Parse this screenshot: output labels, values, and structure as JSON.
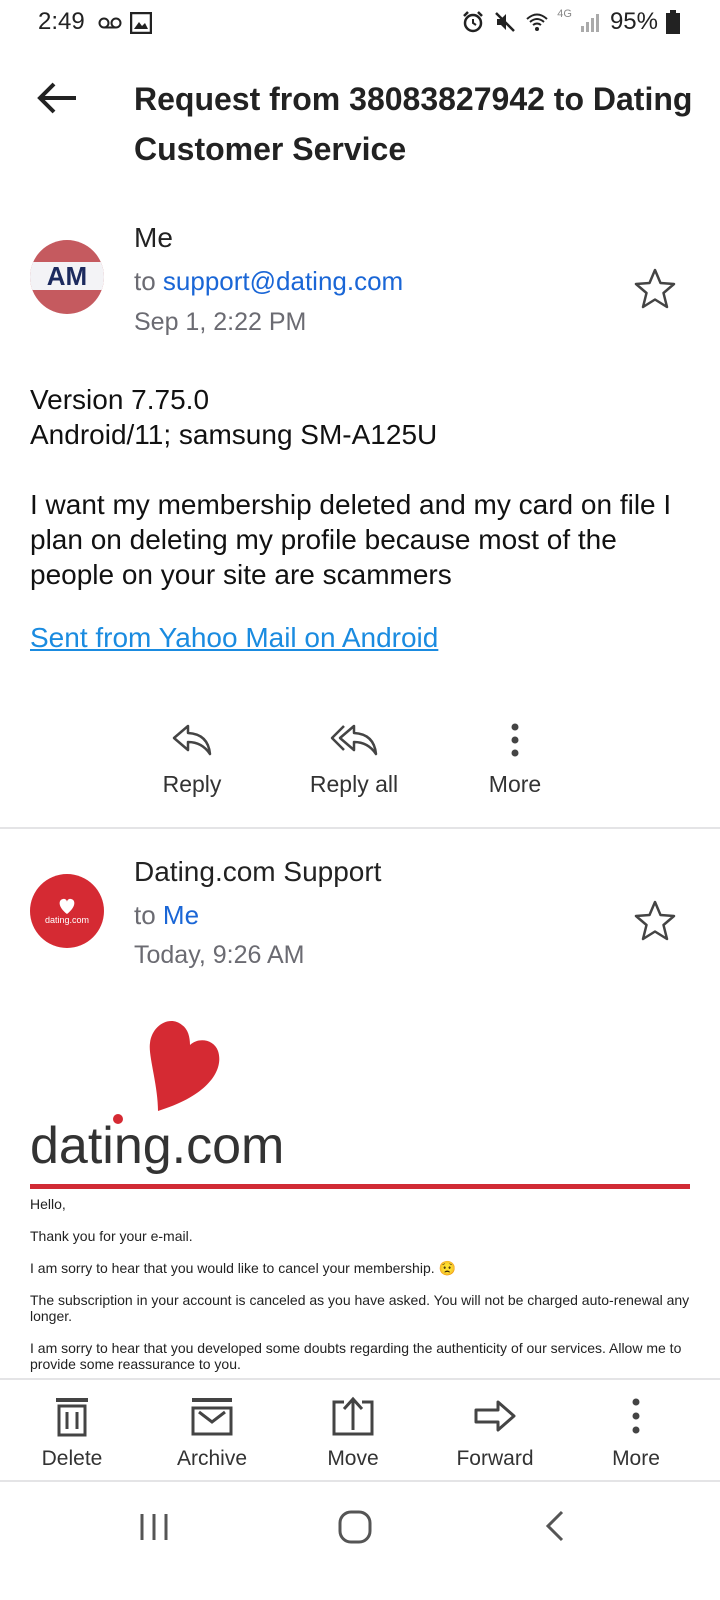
{
  "status_bar": {
    "time": "2:49",
    "battery": "95%",
    "network": "4G",
    "icons": [
      "voicemail-icon",
      "image-icon",
      "alarm-icon",
      "mute-icon",
      "wifi-icon",
      "signal-icon",
      "battery-icon"
    ]
  },
  "header": {
    "subject": "Request from 38083827942 to Dating Customer Service"
  },
  "message1": {
    "avatar_text": "AM",
    "sender": "Me",
    "to_prefix": "to",
    "to": "support@dating.com",
    "date": "Sep 1, 2:22 PM",
    "body_line1": "Version 7.75.0",
    "body_line2": "Android/11; samsung SM-A125U",
    "body_paragraph": "I want my membership deleted and my card on file I plan on deleting my profile because most of the people on your site are scammers",
    "signature_link": "Sent from Yahoo Mail on Android",
    "actions": {
      "reply": "Reply",
      "reply_all": "Reply all",
      "more": "More"
    }
  },
  "message2": {
    "avatar_text": "dating.com",
    "sender": "Dating.com Support",
    "to_prefix": "to",
    "to": "Me",
    "date": "Today, 9:26 AM",
    "logo_text": "dating.com",
    "lines": [
      "Hello,",
      "Thank you for your e-mail.",
      "I am sorry to hear that you would like to cancel your membership. 😟",
      "The subscription in your account is canceled as you have asked. You will not be charged auto-renewal any longer.",
      "I am sorry to hear that you developed some doubts regarding the authenticity of our services. Allow me to provide some reassurance to you."
    ]
  },
  "toolbar": {
    "delete": "Delete",
    "archive": "Archive",
    "move": "Move",
    "forward": "Forward",
    "more": "More"
  },
  "colors": {
    "accent_blue": "#1a66d6",
    "link_blue": "#1a8be0",
    "brand_red": "#d12b35"
  }
}
